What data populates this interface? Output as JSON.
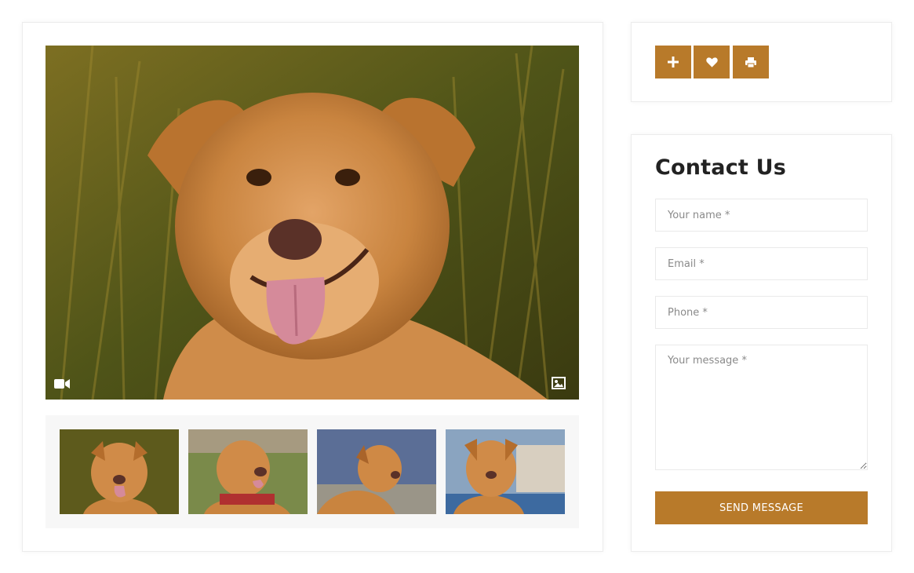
{
  "gallery": {
    "main_image": "dog-portrait-photo",
    "overlay_icons": [
      "video-camera-icon",
      "image-icon"
    ],
    "thumbnails": [
      {
        "name": "dog-thumbnail-1"
      },
      {
        "name": "dog-thumbnail-2"
      },
      {
        "name": "dog-thumbnail-3"
      },
      {
        "name": "dog-thumbnail-4"
      }
    ]
  },
  "actions": {
    "buttons": [
      "plus-icon",
      "heart-icon",
      "print-icon"
    ]
  },
  "contact": {
    "title": "Contact Us",
    "name_placeholder": "Your name *",
    "email_placeholder": "Email *",
    "phone_placeholder": "Phone *",
    "message_placeholder": "Your message *",
    "send_label": "SEND MESSAGE"
  },
  "colors": {
    "accent": "#b87a2a",
    "thumb_strip_bg": "#f7f7f7"
  }
}
